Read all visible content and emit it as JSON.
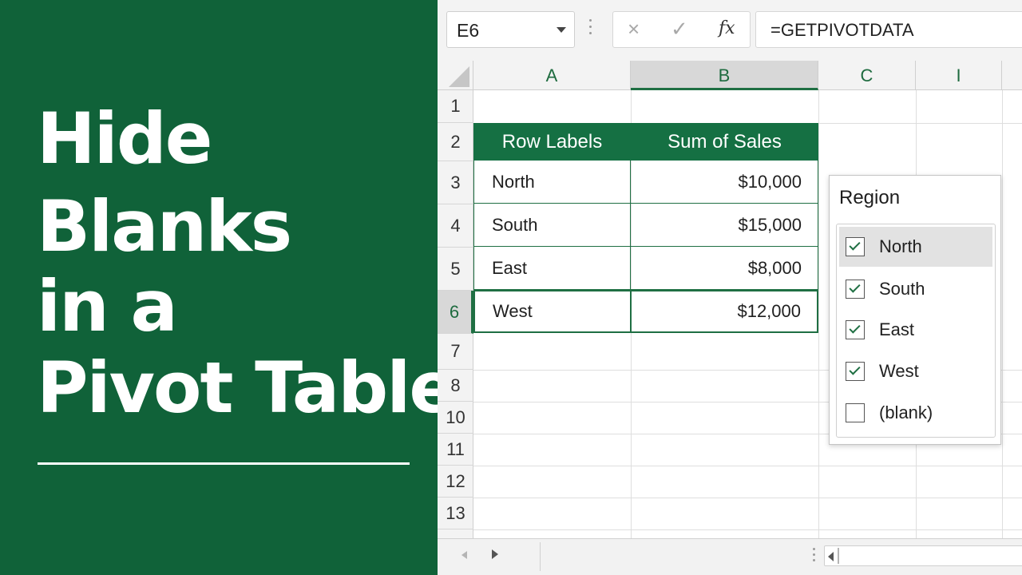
{
  "title": {
    "lines": [
      "Hide",
      "Blanks",
      "in a",
      "Pivot Table"
    ]
  },
  "formula_bar": {
    "name_box": "E6",
    "cancel_icon": "×",
    "enter_icon": "✓",
    "fx_label": "fx",
    "formula": "=GETPIVOTDATA"
  },
  "columns": [
    {
      "label": "A",
      "selected": false
    },
    {
      "label": "B",
      "selected": true
    },
    {
      "label": "C",
      "selected": false
    },
    {
      "label": "I",
      "selected": false
    }
  ],
  "rows": [
    "1",
    "2",
    "3",
    "4",
    "5",
    "6",
    "7",
    "8",
    "10",
    "11",
    "12",
    "13"
  ],
  "selected_row": "6",
  "pivot": {
    "headers": [
      "Row Labels",
      "Sum of Sales"
    ],
    "rows": [
      {
        "label": "North",
        "value": "$10,000"
      },
      {
        "label": "South",
        "value": "$15,000"
      },
      {
        "label": "East",
        "value": "$8,000"
      },
      {
        "label": "West",
        "value": "$12,000"
      }
    ]
  },
  "filter": {
    "title": "Region",
    "items": [
      {
        "label": "North",
        "checked": true,
        "highlighted": true
      },
      {
        "label": "South",
        "checked": true,
        "highlighted": false
      },
      {
        "label": "East",
        "checked": true,
        "highlighted": false
      },
      {
        "label": "West",
        "checked": true,
        "highlighted": false
      },
      {
        "label": "(blank)",
        "checked": false,
        "highlighted": false
      }
    ]
  },
  "colors": {
    "brand_green": "#106239",
    "header_green": "#157043",
    "accent_green": "#1f6f43"
  },
  "icons": {
    "name_box_dropdown": "chevron-down-icon",
    "cancel": "close-icon",
    "enter": "check-icon",
    "function": "function-icon",
    "checkbox_checked": "checkbox-checked-icon",
    "checkbox_unchecked": "checkbox-unchecked-icon"
  }
}
